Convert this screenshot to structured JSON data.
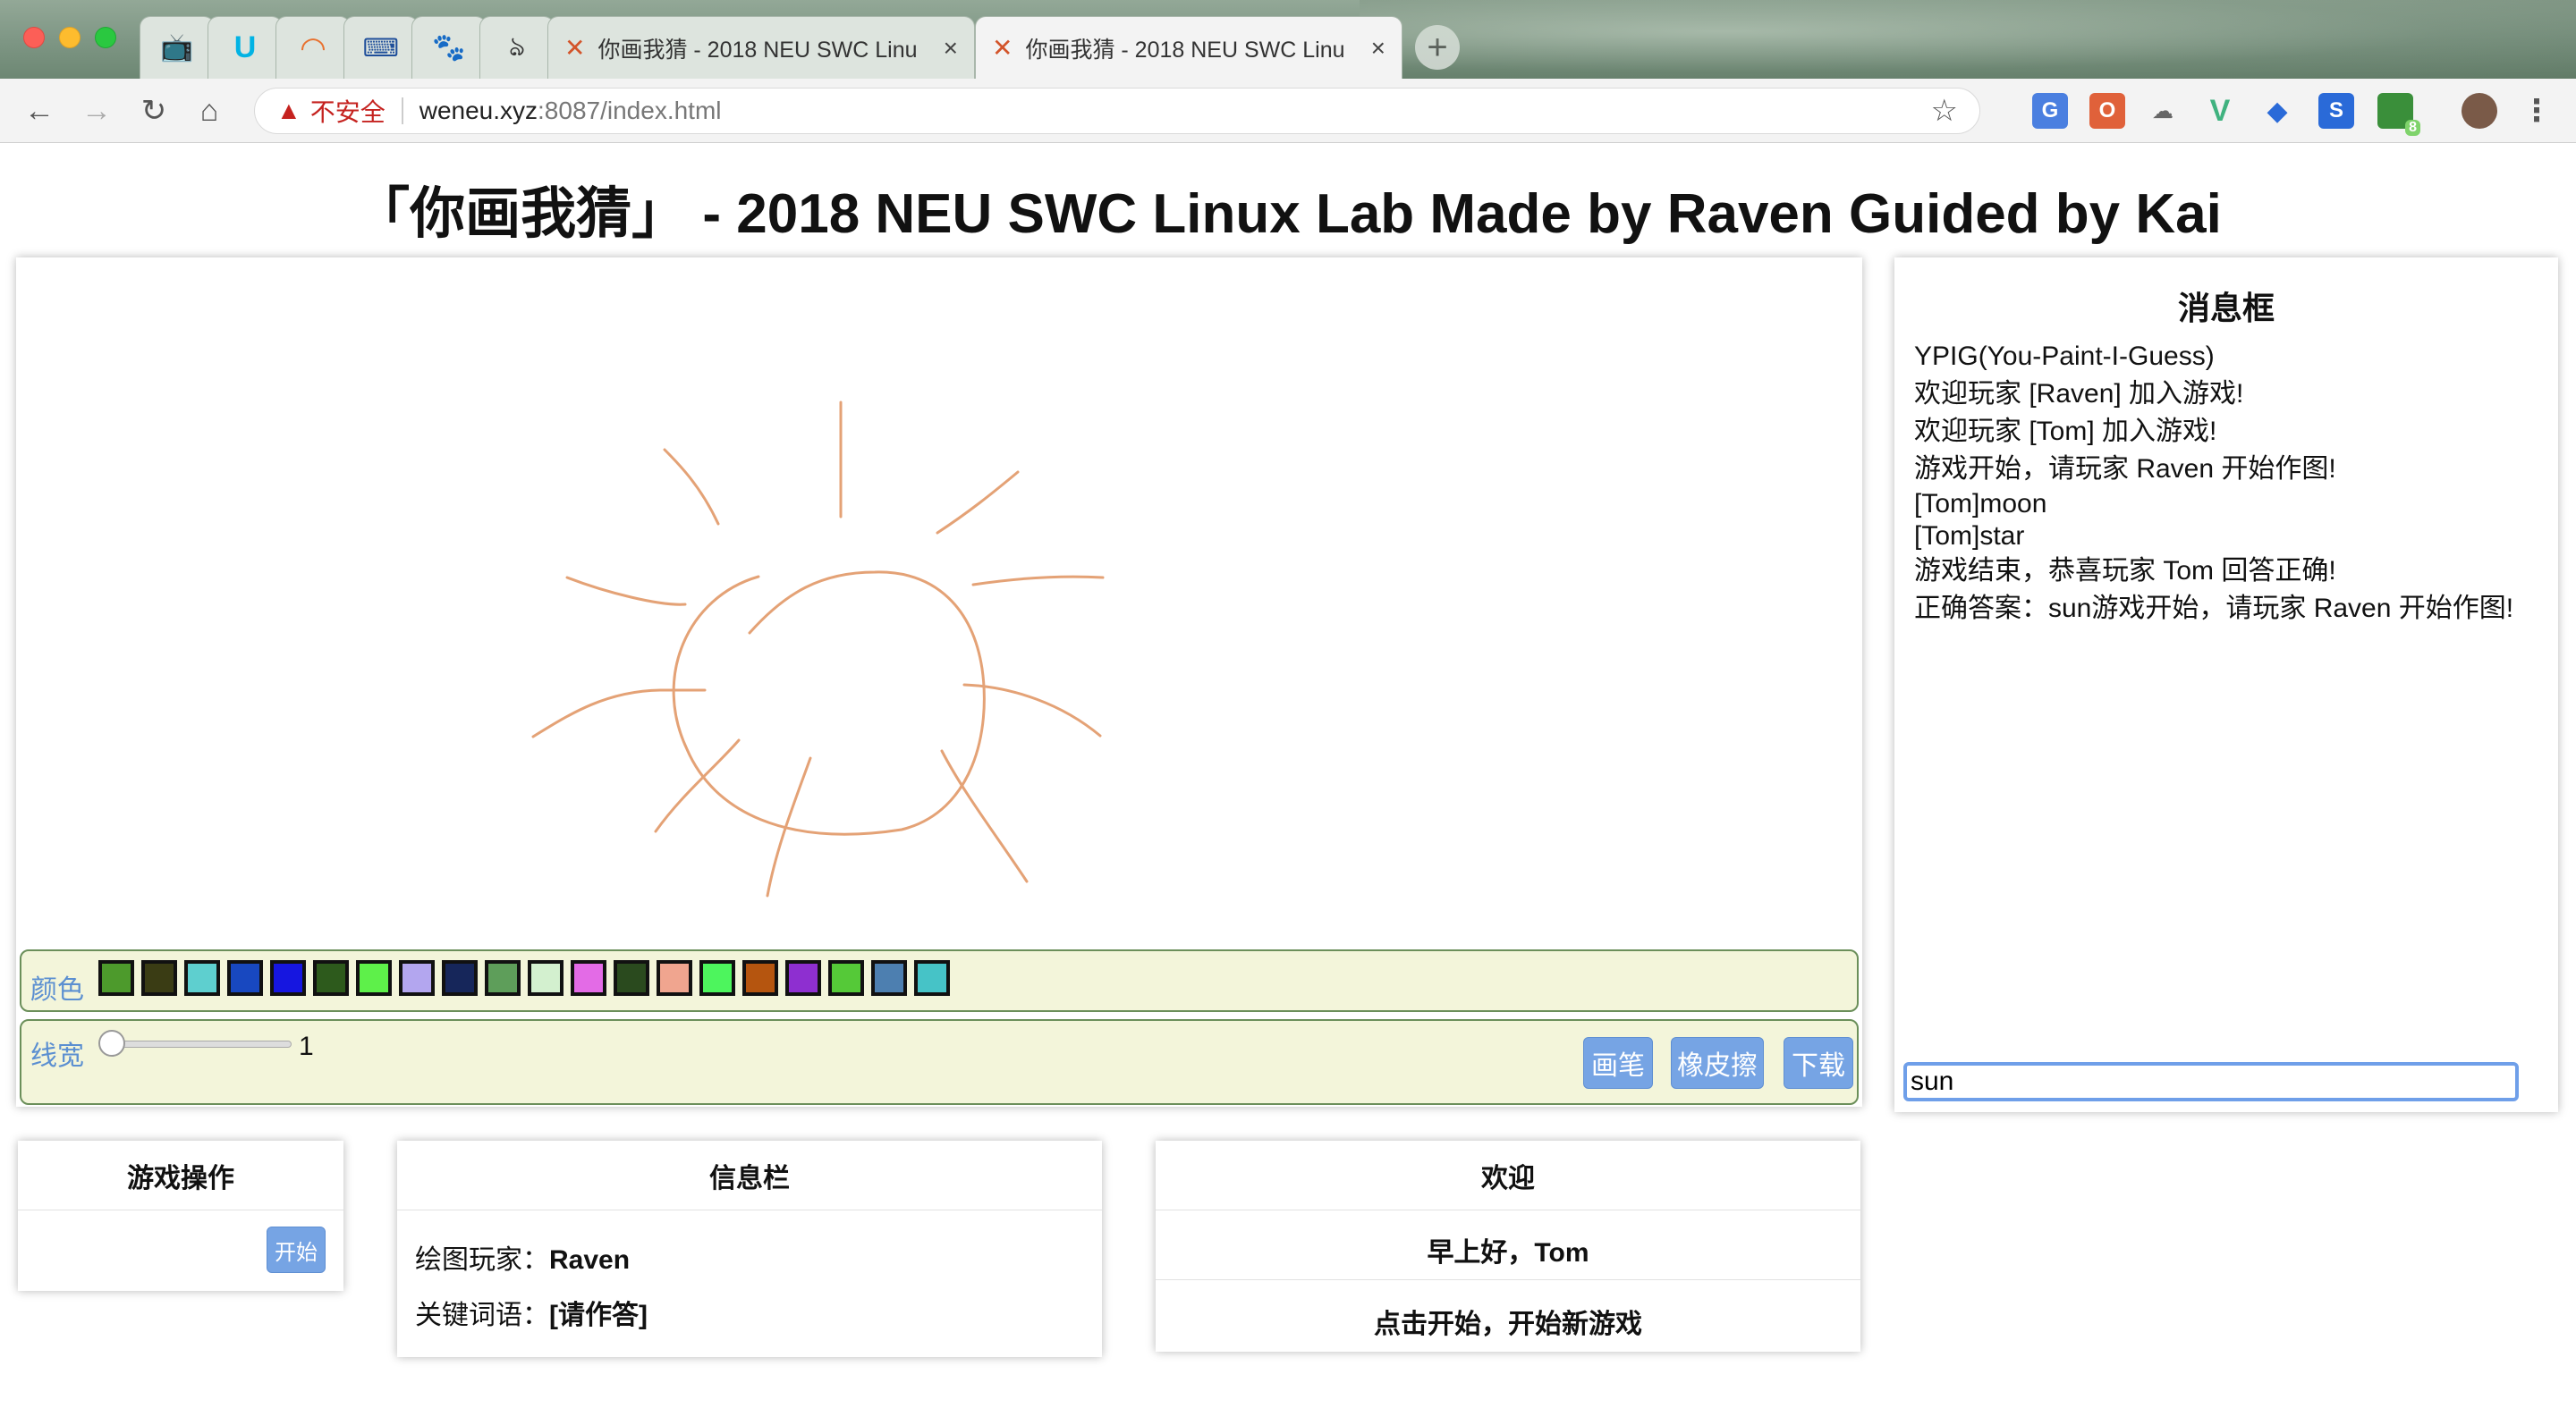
{
  "browser": {
    "tabs": [
      {
        "title": "你画我猜 - 2018 NEU SWC Linu",
        "active": false
      },
      {
        "title": "你画我猜 - 2018 NEU SWC Linu",
        "active": true
      }
    ],
    "address": {
      "security_label": "不安全",
      "host": "weneu.xyz",
      "path": ":8087/index.html"
    },
    "pinned_tabs": [
      "tv-icon",
      "udacity-icon",
      "loading-icon",
      "devtools-icon",
      "baidu-icon",
      "gesture-icon"
    ],
    "extension_badge": "8"
  },
  "page": {
    "title": "「你画我猜」 - 2018 NEU SWC Linux Lab Made by Raven Guided by Kai"
  },
  "toolbox": {
    "color_label": "颜色",
    "colors": [
      "#4d9a2c",
      "#3a3c14",
      "#5ecfcf",
      "#1848c0",
      "#1616e0",
      "#2d5a1c",
      "#5ef04a",
      "#b3a6ef",
      "#16265a",
      "#5e9e5a",
      "#d3f0cf",
      "#e36be6",
      "#2a4a1e",
      "#f0a58f",
      "#4df55d",
      "#b5550f",
      "#8e2fd0",
      "#55c938",
      "#4d7fb0",
      "#46c3c7"
    ],
    "width_label": "线宽",
    "width_value": 1,
    "pen_label": "画笔",
    "eraser_label": "橡皮擦",
    "download_label": "下载",
    "stroke_color": "#e4a276"
  },
  "messages": {
    "title": "消息框",
    "lines": [
      "YPIG(You-Paint-I-Guess)",
      "欢迎玩家 [Raven] 加入游戏!",
      "欢迎玩家 [Tom] 加入游戏!",
      "游戏开始，请玩家 Raven 开始作图!",
      "[Tom]moon",
      "[Tom]star",
      "游戏结束，恭喜玩家 Tom 回答正确!",
      "正确答案：sun游戏开始，请玩家 Raven 开始作图!"
    ],
    "input_value": "sun"
  },
  "ops": {
    "title": "游戏操作",
    "start_label": "开始"
  },
  "info": {
    "title": "信息栏",
    "drawer_label": "绘图玩家：",
    "drawer_value": "Raven",
    "keyword_label": "关键词语：",
    "keyword_value": "[请作答]"
  },
  "welcome": {
    "title": "欢迎",
    "greeting": "早上好，Tom",
    "hint": "点击开始，开始新游戏"
  }
}
